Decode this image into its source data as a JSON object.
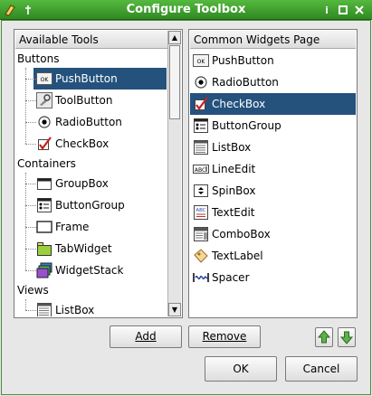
{
  "window": {
    "title": "Configure Toolbox",
    "help_glyph": "i",
    "accent": "#3d9a2d"
  },
  "available": {
    "header": "Available Tools",
    "categories": [
      {
        "name": "Buttons",
        "items": [
          {
            "label": "PushButton",
            "icon": "pushbutton-icon",
            "selected": true
          },
          {
            "label": "ToolButton",
            "icon": "toolbutton-icon"
          },
          {
            "label": "RadioButton",
            "icon": "radiobutton-icon"
          },
          {
            "label": "CheckBox",
            "icon": "checkbox-icon"
          }
        ]
      },
      {
        "name": "Containers",
        "items": [
          {
            "label": "GroupBox",
            "icon": "groupbox-icon"
          },
          {
            "label": "ButtonGroup",
            "icon": "buttongroup-icon"
          },
          {
            "label": "Frame",
            "icon": "frame-icon"
          },
          {
            "label": "TabWidget",
            "icon": "tabwidget-icon"
          },
          {
            "label": "WidgetStack",
            "icon": "widgetstack-icon"
          }
        ]
      },
      {
        "name": "Views",
        "items": [
          {
            "label": "ListBox",
            "icon": "listbox-icon"
          }
        ]
      }
    ]
  },
  "common": {
    "header": "Common Widgets Page",
    "items": [
      {
        "label": "PushButton",
        "icon": "pushbutton-icon"
      },
      {
        "label": "RadioButton",
        "icon": "radiobutton-icon"
      },
      {
        "label": "CheckBox",
        "icon": "checkbox-icon",
        "selected": true
      },
      {
        "label": "ButtonGroup",
        "icon": "buttongroup-icon"
      },
      {
        "label": "ListBox",
        "icon": "listbox-icon"
      },
      {
        "label": "LineEdit",
        "icon": "lineedit-icon"
      },
      {
        "label": "SpinBox",
        "icon": "spinbox-icon"
      },
      {
        "label": "TextEdit",
        "icon": "textedit-icon"
      },
      {
        "label": "ComboBox",
        "icon": "combobox-icon"
      },
      {
        "label": "TextLabel",
        "icon": "textlabel-icon"
      },
      {
        "label": "Spacer",
        "icon": "spacer-icon"
      }
    ]
  },
  "buttons": {
    "add": "Add",
    "remove": "Remove",
    "ok": "OK",
    "cancel": "Cancel"
  },
  "icon_glyphs": {
    "pushbutton-icon": "OK",
    "lineedit-icon": "ABC",
    "textedit-icon": "ABC"
  }
}
